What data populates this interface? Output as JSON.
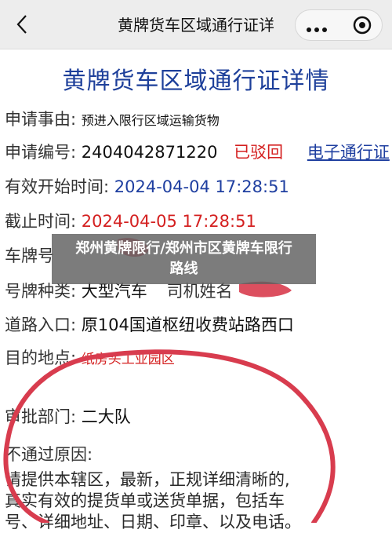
{
  "nav": {
    "title": "黄牌货车区域通行证详情",
    "back_icon": "chevron-left-icon",
    "more_icon": "more-dots-icon",
    "close_icon": "target-close-icon"
  },
  "document": {
    "title": "黄牌货车区域通行证详情",
    "fields": {
      "apply_reason": {
        "label": "申请事由:",
        "value": "预进入限行区域运输货物"
      },
      "apply_no": {
        "label": "申请编号:",
        "value": "2404042871220",
        "status": "已驳回",
        "link": "电子通行证"
      },
      "valid_start": {
        "label": "有效开始时间:",
        "value": "2024-04-04 17:28:51"
      },
      "end_time": {
        "label": "截止时间:",
        "value": "2024-04-05 17:28:51"
      },
      "plate_no": {
        "label": "车牌号",
        "value": ""
      },
      "plate_type": {
        "label": "号牌种类:",
        "value": "大型汽车",
        "driver_label": "司机姓名"
      },
      "road_entry": {
        "label": "道路入口:",
        "value": "原104国道枢纽收费站路西口"
      },
      "destination": {
        "label": "目的地点:",
        "value": "纸房头工业园区"
      },
      "approval_dept": {
        "label": "审批部门:",
        "value": "二大队"
      },
      "reject_reason": {
        "label": "不通过原因:",
        "lines": [
          "请提供本辖区，最新，正规详细清晰的,",
          "真实有效的提货单或送货单据，包括车",
          "号、详细地址、日期、印章、以及电话。"
        ]
      }
    }
  },
  "overlay": {
    "line1": "郑州黄牌限行/郑州市区黄牌车限行",
    "line2": "路线"
  },
  "colors": {
    "title_blue": "#1d3f9a",
    "red": "#d42020",
    "ink": "#d83c4e"
  }
}
